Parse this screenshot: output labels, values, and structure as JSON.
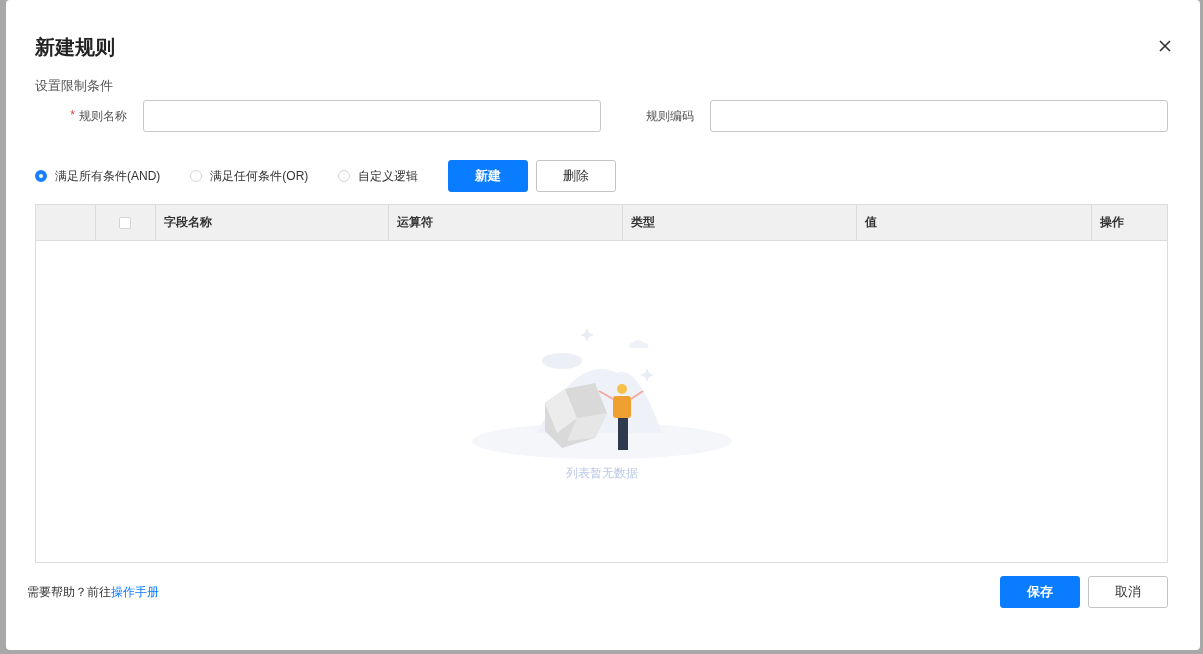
{
  "dialog": {
    "title": "新建规则",
    "section_title": "设置限制条件",
    "fields": [
      {
        "label": "规则名称",
        "required_mark": "*"
      },
      {
        "label": "规则编码"
      }
    ],
    "logic_options": [
      {
        "label": "满足所有条件(AND)",
        "selected": true
      },
      {
        "label": "满足任何条件(OR)",
        "selected": false
      },
      {
        "label": "自定义逻辑",
        "selected": false
      }
    ],
    "toolbar_buttons": [
      {
        "label": "新建",
        "kind": "primary"
      },
      {
        "label": "删除",
        "kind": "default"
      }
    ],
    "table": {
      "columns": [
        {
          "kind": "blank"
        },
        {
          "kind": "checkbox",
          "checked": false
        },
        {
          "kind": "text",
          "label": "字段名称"
        },
        {
          "kind": "text",
          "label": "运算符"
        },
        {
          "kind": "text",
          "label": "类型"
        },
        {
          "kind": "text",
          "label": "值"
        },
        {
          "kind": "text",
          "label": "操作"
        }
      ],
      "empty_text": "列表暂无数据"
    },
    "help": {
      "text": "需要帮助？前往",
      "link": "操作手册"
    },
    "footer_buttons": [
      {
        "label": "保存",
        "kind": "primary"
      },
      {
        "label": "取消",
        "kind": "default"
      }
    ]
  }
}
